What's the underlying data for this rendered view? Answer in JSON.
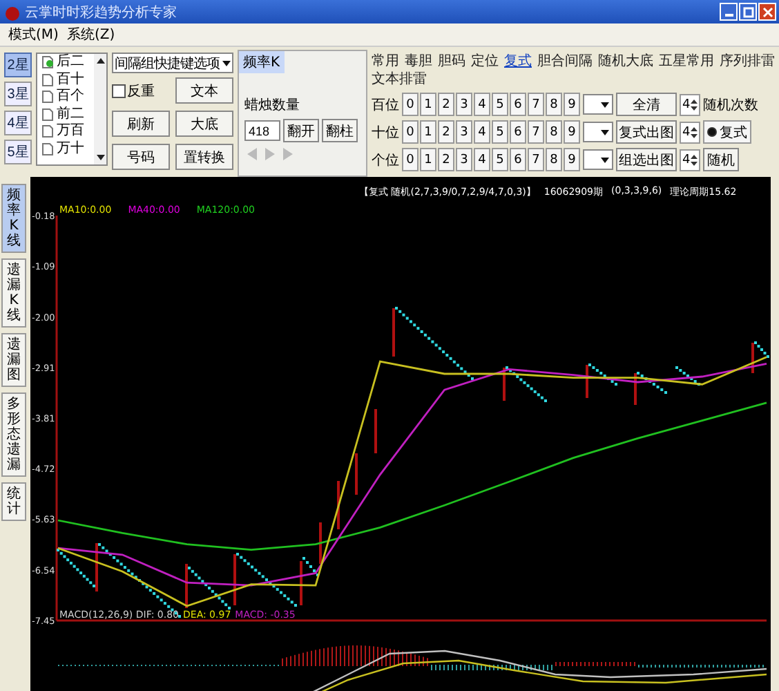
{
  "window": {
    "title": "云掌时时彩趋势分析专家"
  },
  "menu": [
    "模式(M)",
    "系统(Z)"
  ],
  "star_buttons": [
    {
      "label": "2星",
      "selected": true
    },
    {
      "label": "3星",
      "selected": false
    },
    {
      "label": "4星",
      "selected": false
    },
    {
      "label": "5星",
      "selected": false
    }
  ],
  "position_list": [
    {
      "label": "后二",
      "selected": true
    },
    {
      "label": "百十",
      "selected": false
    },
    {
      "label": "百个",
      "selected": false
    },
    {
      "label": "前二",
      "selected": false
    },
    {
      "label": "万百",
      "selected": false
    },
    {
      "label": "万十",
      "selected": false
    }
  ],
  "quick_select": {
    "value": "间隔组快捷键选项"
  },
  "reverse_checkbox": {
    "label": "反重",
    "checked": false
  },
  "tool_buttons": [
    "文本",
    "刷新",
    "大底",
    "号码",
    "置转换"
  ],
  "kline_panel": {
    "tab": "频率K",
    "label": "蜡烛数量",
    "value": "418",
    "buttons": [
      "翻开",
      "翻柱"
    ]
  },
  "filter_tabs": [
    {
      "label": "常用",
      "selected": false
    },
    {
      "label": "毒胆",
      "selected": false
    },
    {
      "label": "胆码",
      "selected": false
    },
    {
      "label": "定位",
      "selected": false
    },
    {
      "label": "复式",
      "selected": true
    },
    {
      "label": "胆合间隔",
      "selected": false
    },
    {
      "label": "随机大底",
      "selected": false
    },
    {
      "label": "五星常用",
      "selected": false
    },
    {
      "label": "序列排雷",
      "selected": false
    },
    {
      "label": "文本排雷",
      "selected": false
    }
  ],
  "digit_rows": [
    {
      "label": "百位",
      "digits": [
        "0",
        "1",
        "2",
        "3",
        "4",
        "5",
        "6",
        "7",
        "8",
        "9"
      ],
      "action": "全清",
      "spinner": "4"
    },
    {
      "label": "十位",
      "digits": [
        "0",
        "1",
        "2",
        "3",
        "4",
        "5",
        "6",
        "7",
        "8",
        "9"
      ],
      "action": "复式出图",
      "spinner": "4"
    },
    {
      "label": "个位",
      "digits": [
        "0",
        "1",
        "2",
        "3",
        "4",
        "5",
        "6",
        "7",
        "8",
        "9"
      ],
      "action": "组选出图",
      "spinner": "4"
    }
  ],
  "random_count_label": "随机次数",
  "mode_radio": {
    "label": "复式",
    "selected": true
  },
  "random_button": "随机",
  "side_tabs": [
    {
      "label": "频率K线",
      "selected": true
    },
    {
      "label": "遗漏K线",
      "selected": false
    },
    {
      "label": "遗漏图",
      "selected": false
    },
    {
      "label": "多形态遗漏",
      "selected": false
    },
    {
      "label": "统计",
      "selected": false
    }
  ],
  "chart": {
    "info": "【复式 随机(2,7,3,9/0,7,2,9/4,7,0,3)】",
    "period": "16062909期",
    "numbers": "(0,3,3,9,6)",
    "cycle": "理论周期15.62",
    "ma_labels": [
      {
        "text": "MA10:0.00",
        "color": "#e0e000"
      },
      {
        "text": "MA40:0.00",
        "color": "#e000e0"
      },
      {
        "text": "MA120:0.00",
        "color": "#20d020"
      }
    ],
    "chart_data": {
      "type": "line",
      "ylim": [
        -7.45,
        -0.18
      ],
      "yticks": [
        {
          "value": -0.18,
          "label": "-0.18"
        },
        {
          "value": -1.09,
          "label": "-1.09"
        },
        {
          "value": -2,
          "label": "-2.00"
        },
        {
          "value": -2.91,
          "label": "-2.91"
        },
        {
          "value": -3.81,
          "label": "-3.81"
        },
        {
          "value": -4.72,
          "label": "-4.72"
        },
        {
          "value": -5.63,
          "label": "-5.63"
        },
        {
          "value": -6.54,
          "label": "-6.54"
        },
        {
          "value": -7.45,
          "label": "-7.45"
        }
      ],
      "series": [
        {
          "color": "#20c020",
          "values": [
            -5.65,
            -5.88,
            -6.08,
            -6.18,
            -6.08,
            -5.78,
            -5.38,
            -4.96,
            -4.53,
            -4.18,
            -3.86,
            -3.54
          ]
        },
        {
          "color": "#c020c0",
          "values": [
            -6.15,
            -6.27,
            -6.77,
            -6.82,
            -6.6,
            -4.83,
            -3.31,
            -2.94,
            -3.04,
            -3.17,
            -3.07,
            -2.84
          ]
        },
        {
          "color": "#c8c020",
          "values": [
            -6.15,
            -6.57,
            -7.19,
            -6.8,
            -6.82,
            -2.8,
            -3.02,
            -3.02,
            -3.09,
            -3.09,
            -3.21,
            -2.72
          ]
        }
      ]
    },
    "macd_labels": [
      {
        "text": "MACD(12,26,9) DIF: 0.80",
        "color": "#d0d0d0"
      },
      {
        "text": "DEA: 0.97",
        "color": "#e0e000"
      },
      {
        "text": "MACD: -0.35",
        "color": "#c020c0"
      }
    ]
  }
}
